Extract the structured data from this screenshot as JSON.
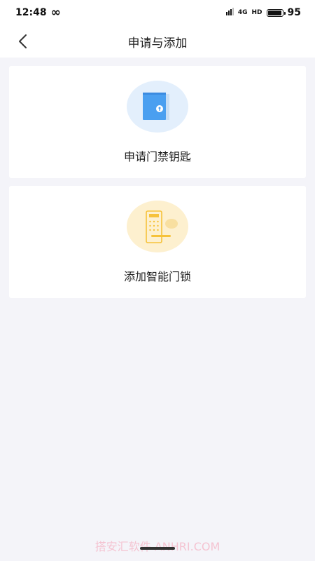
{
  "status": {
    "time": "12:48",
    "link_icon": "infinity-icon",
    "network": "4G",
    "hd": "HD",
    "battery": "95",
    "battery_level": 0.95
  },
  "nav": {
    "title": "申请与添加",
    "back_icon": "chevron-left-icon"
  },
  "cards": [
    {
      "label": "申请门禁钥匙",
      "icon": "door-key-icon",
      "accent": "#4a9ff0"
    },
    {
      "label": "添加智能门锁",
      "icon": "smart-lock-icon",
      "accent": "#f6c23a"
    }
  ],
  "watermark": "搭安汇软件 ANHRI.COM"
}
